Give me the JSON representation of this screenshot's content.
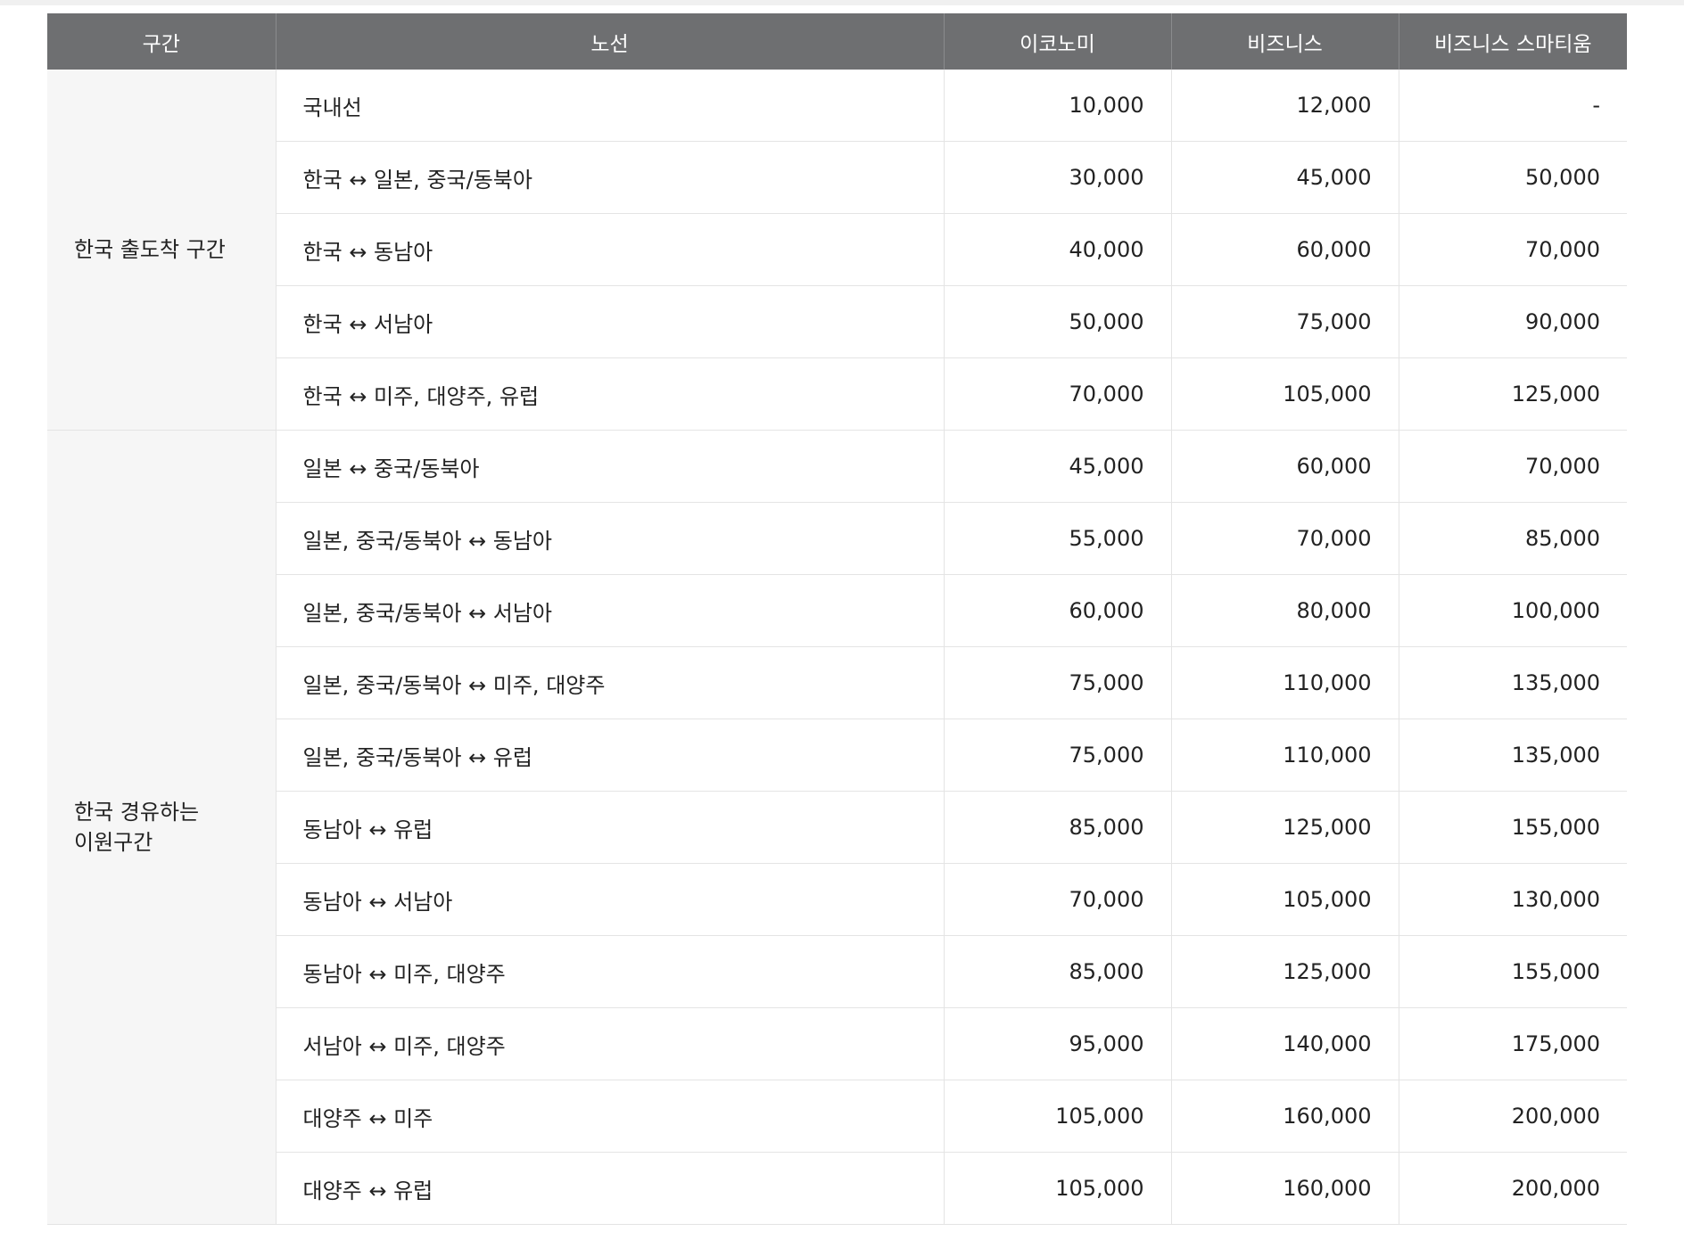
{
  "table": {
    "headers": [
      "구간",
      "노선",
      "이코노미",
      "비즈니스",
      "비즈니스 스마티움"
    ],
    "groups": [
      {
        "zone": "한국 출도착 구간",
        "rows": [
          {
            "route": "국내선",
            "economy": "10,000",
            "business": "12,000",
            "smartium": "-"
          },
          {
            "route": "한국 ↔ 일본, 중국/동북아",
            "economy": "30,000",
            "business": "45,000",
            "smartium": "50,000"
          },
          {
            "route": "한국 ↔ 동남아",
            "economy": "40,000",
            "business": "60,000",
            "smartium": "70,000"
          },
          {
            "route": "한국 ↔ 서남아",
            "economy": "50,000",
            "business": "75,000",
            "smartium": "90,000"
          },
          {
            "route": "한국 ↔ 미주, 대양주, 유럽",
            "economy": "70,000",
            "business": "105,000",
            "smartium": "125,000"
          }
        ]
      },
      {
        "zone_line1": "한국 경유하는",
        "zone_line2": "이원구간",
        "rows": [
          {
            "route": "일본 ↔ 중국/동북아",
            "economy": "45,000",
            "business": "60,000",
            "smartium": "70,000"
          },
          {
            "route": "일본, 중국/동북아 ↔ 동남아",
            "economy": "55,000",
            "business": "70,000",
            "smartium": "85,000"
          },
          {
            "route": "일본, 중국/동북아 ↔ 서남아",
            "economy": "60,000",
            "business": "80,000",
            "smartium": "100,000"
          },
          {
            "route": "일본, 중국/동북아 ↔ 미주, 대양주",
            "economy": "75,000",
            "business": "110,000",
            "smartium": "135,000"
          },
          {
            "route": "일본, 중국/동북아 ↔ 유럽",
            "economy": "75,000",
            "business": "110,000",
            "smartium": "135,000"
          },
          {
            "route": "동남아 ↔ 유럽",
            "economy": "85,000",
            "business": "125,000",
            "smartium": "155,000"
          },
          {
            "route": "동남아 ↔ 서남아",
            "economy": "70,000",
            "business": "105,000",
            "smartium": "130,000"
          },
          {
            "route": "동남아 ↔ 미주, 대양주",
            "economy": "85,000",
            "business": "125,000",
            "smartium": "155,000"
          },
          {
            "route": "서남아 ↔ 미주, 대양주",
            "economy": "95,000",
            "business": "140,000",
            "smartium": "175,000"
          },
          {
            "route": "대양주 ↔ 미주",
            "economy": "105,000",
            "business": "160,000",
            "smartium": "200,000"
          },
          {
            "route": "대양주 ↔ 유럽",
            "economy": "105,000",
            "business": "160,000",
            "smartium": "200,000"
          }
        ]
      }
    ]
  }
}
